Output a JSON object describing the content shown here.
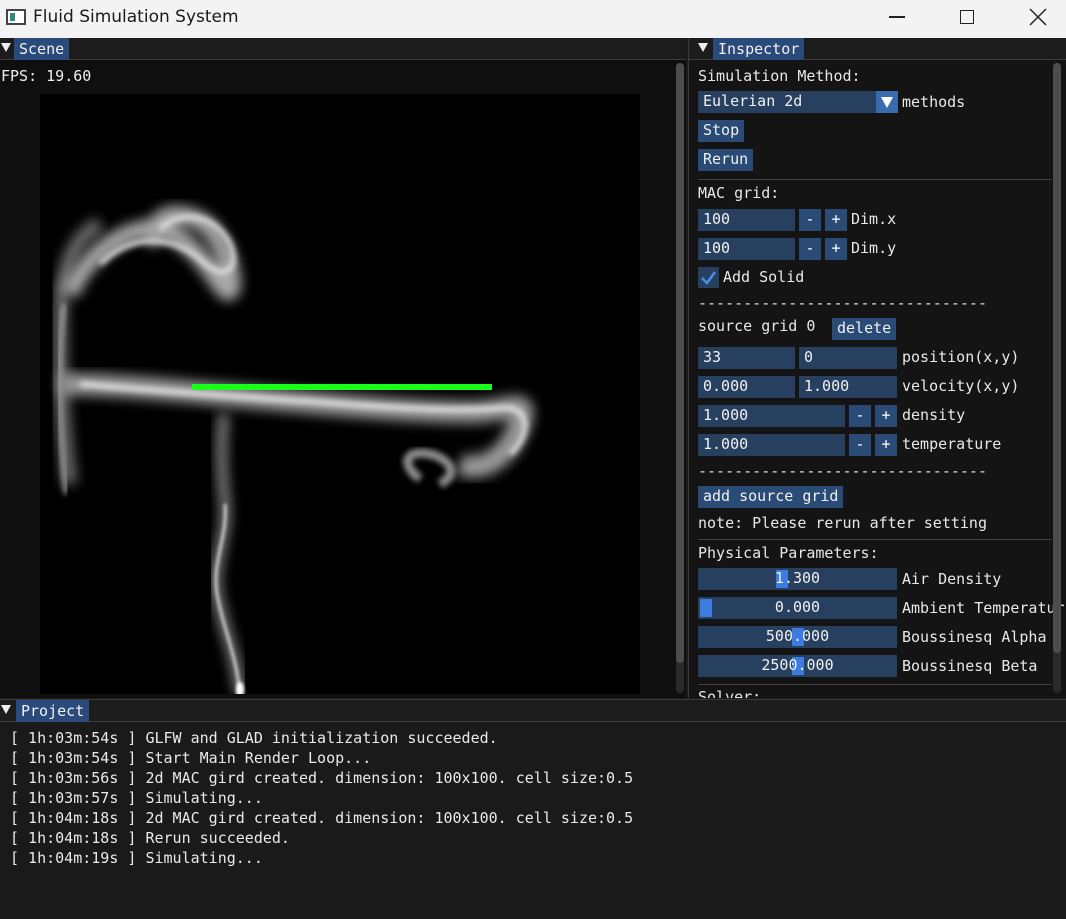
{
  "window": {
    "title": "Fluid Simulation System"
  },
  "scene": {
    "tab_label": "Scene",
    "fps_text": "FPS: 19.60",
    "smoke_color": "#c8c8c8",
    "solid_color": "#19ff19"
  },
  "inspector": {
    "tab_label": "Inspector",
    "method_label": "Simulation Method:",
    "method_value": "Eulerian 2d",
    "method_suffix": "methods",
    "stop_label": "Stop",
    "rerun_label": "Rerun",
    "mac_grid_label": "MAC grid:",
    "dim_x": {
      "value": "100",
      "minus": "-",
      "plus": "+",
      "label": "Dim.x"
    },
    "dim_y": {
      "value": "100",
      "minus": "-",
      "plus": "+",
      "label": "Dim.y"
    },
    "add_solid": {
      "checked": true,
      "label": "Add Solid"
    },
    "dashes": "--------------------------------",
    "source_grid": {
      "title": "source grid 0",
      "delete_label": "delete",
      "position": {
        "x": "33",
        "y": "0",
        "label": "position(x,y)"
      },
      "velocity": {
        "x": "0.000",
        "y": "1.000",
        "label": "velocity(x,y)"
      },
      "density": {
        "value": "1.000",
        "minus": "-",
        "plus": "+",
        "label": "density"
      },
      "temperature": {
        "value": "1.000",
        "minus": "-",
        "plus": "+",
        "label": "temperature"
      }
    },
    "add_source_label": "add source grid",
    "note": "note: Please rerun after setting",
    "physical_label": "Physical Parameters:",
    "params": [
      {
        "value": "1.300",
        "label": "Air Density"
      },
      {
        "value": "0.000",
        "label": "Ambient Temperatur"
      },
      {
        "value": "500.000",
        "label": "Boussinesq Alpha"
      },
      {
        "value": "2500.000",
        "label": "Boussinesq Beta"
      }
    ],
    "solver_label": "Solver:"
  },
  "project": {
    "tab_label": "Project",
    "log": [
      "[ 1h:03m:54s ] GLFW and GLAD initialization succeeded.",
      "[ 1h:03m:54s ] Start Main Render Loop...",
      "[ 1h:03m:56s ] 2d MAC gird created. dimension: 100x100. cell size:0.5",
      "[ 1h:03m:57s ] Simulating...",
      "[ 1h:04m:18s ] 2d MAC gird created. dimension: 100x100. cell size:0.5",
      "[ 1h:04m:18s ] Rerun succeeded.",
      "[ 1h:04m:19s ] Simulating..."
    ]
  },
  "colors": {
    "accent": "#294a7a",
    "field_bg": "#28405f",
    "slider_grab": "#3d7be0"
  }
}
